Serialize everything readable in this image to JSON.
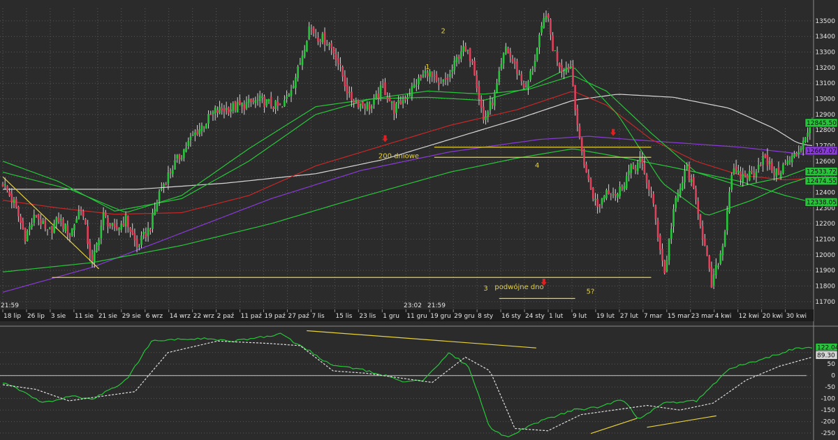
{
  "chart_data": [
    {
      "type": "candlestick",
      "ylim": [
        11650,
        13580
      ],
      "y_ticks": [
        11700,
        11800,
        11900,
        12000,
        12100,
        12200,
        12300,
        12400,
        12500,
        12600,
        12700,
        12800,
        12900,
        13000,
        13100,
        13200,
        13300,
        13400,
        13500
      ],
      "x_tick_labels": [
        "18 lip",
        "26 lip",
        "3 sie",
        "11 sie",
        "21 sie",
        "29 sie",
        "6 wrz",
        "14 wrz",
        "22 wrz",
        "2 paź",
        "11 paź",
        "19 paź",
        "27 paź",
        "7 lis",
        "15 lis",
        "23 lis",
        "1 gru",
        "11 gru",
        "19 gru",
        "29 gru",
        "8 sty",
        "16 sty",
        "24 sty",
        "1 lut",
        "9 lut",
        "19 lut",
        "27 lut",
        "7 mar",
        "15 mar",
        "23 mar",
        "4 kwi",
        "12 kwi",
        "20 kwi",
        "30 kwi"
      ],
      "time_labels": [
        "21:59",
        "23:02",
        "21:59"
      ],
      "grid": true,
      "ohlc_anchors": [
        [
          0,
          12460
        ],
        [
          5,
          12330
        ],
        [
          10,
          12120
        ],
        [
          15,
          12260
        ],
        [
          20,
          12130
        ],
        [
          25,
          12230
        ],
        [
          30,
          12130
        ],
        [
          35,
          12310
        ],
        [
          40,
          11940
        ],
        [
          45,
          12250
        ],
        [
          50,
          12150
        ],
        [
          55,
          12230
        ],
        [
          60,
          12050
        ],
        [
          66,
          12180
        ],
        [
          70,
          12400
        ],
        [
          75,
          12540
        ],
        [
          85,
          12760
        ],
        [
          95,
          12920
        ],
        [
          105,
          12950
        ],
        [
          115,
          12990
        ],
        [
          125,
          12940
        ],
        [
          132,
          13180
        ],
        [
          137,
          13460
        ],
        [
          141,
          13400
        ],
        [
          145,
          13370
        ],
        [
          149,
          13280
        ],
        [
          155,
          13010
        ],
        [
          160,
          12970
        ],
        [
          165,
          12950
        ],
        [
          170,
          13080
        ],
        [
          175,
          12930
        ],
        [
          180,
          13010
        ],
        [
          185,
          13100
        ],
        [
          190,
          13180
        ],
        [
          195,
          13070
        ],
        [
          200,
          13150
        ],
        [
          205,
          13320
        ],
        [
          210,
          13260
        ],
        [
          215,
          12860
        ],
        [
          220,
          13020
        ],
        [
          225,
          13330
        ],
        [
          230,
          13180
        ],
        [
          234,
          13060
        ],
        [
          238,
          13260
        ],
        [
          243,
          13560
        ],
        [
          246,
          13330
        ],
        [
          250,
          13190
        ],
        [
          254,
          13210
        ],
        [
          258,
          12720
        ],
        [
          262,
          12470
        ],
        [
          266,
          12300
        ],
        [
          270,
          12420
        ],
        [
          275,
          12390
        ],
        [
          280,
          12530
        ],
        [
          285,
          12600
        ],
        [
          290,
          12390
        ],
        [
          296,
          11880
        ],
        [
          300,
          12290
        ],
        [
          306,
          12560
        ],
        [
          311,
          12290
        ],
        [
          317,
          11800
        ],
        [
          322,
          12060
        ],
        [
          326,
          12530
        ],
        [
          330,
          12500
        ],
        [
          335,
          12520
        ],
        [
          340,
          12620
        ],
        [
          346,
          12520
        ],
        [
          350,
          12580
        ],
        [
          355,
          12640
        ],
        [
          361,
          12830
        ]
      ],
      "ma_lines": [
        {
          "color": "#d6d6d6",
          "points": [
            [
              0,
              12420
            ],
            [
              25,
              12420
            ],
            [
              60,
              12420
            ],
            [
              100,
              12460
            ],
            [
              140,
              12520
            ],
            [
              170,
              12610
            ],
            [
              200,
              12740
            ],
            [
              230,
              12870
            ],
            [
              255,
              12990
            ],
            [
              275,
              13030
            ],
            [
              300,
              13010
            ],
            [
              325,
              12940
            ],
            [
              345,
              12810
            ],
            [
              355,
              12720
            ],
            [
              361,
              12700
            ]
          ]
        },
        {
          "color": "#8a3ad8",
          "points": [
            [
              0,
              11760
            ],
            [
              40,
              11920
            ],
            [
              80,
              12140
            ],
            [
              120,
              12360
            ],
            [
              160,
              12540
            ],
            [
              200,
              12660
            ],
            [
              240,
              12740
            ],
            [
              262,
              12760
            ],
            [
              280,
              12740
            ],
            [
              300,
              12720
            ],
            [
              330,
              12690
            ],
            [
              355,
              12650
            ],
            [
              361,
              12640
            ]
          ]
        },
        {
          "color": "#c62828",
          "points": [
            [
              0,
              12350
            ],
            [
              25,
              12300
            ],
            [
              50,
              12260
            ],
            [
              80,
              12270
            ],
            [
              110,
              12380
            ],
            [
              140,
              12570
            ],
            [
              170,
              12700
            ],
            [
              200,
              12830
            ],
            [
              230,
              12930
            ],
            [
              255,
              13050
            ],
            [
              270,
              12960
            ],
            [
              290,
              12740
            ],
            [
              310,
              12600
            ],
            [
              330,
              12510
            ],
            [
              350,
              12480
            ],
            [
              361,
              12490
            ]
          ]
        },
        {
          "color": "#27c63a",
          "points": [
            [
              0,
              11890
            ],
            [
              40,
              11950
            ],
            [
              80,
              12060
            ],
            [
              120,
              12200
            ],
            [
              160,
              12370
            ],
            [
              200,
              12530
            ],
            [
              230,
              12620
            ],
            [
              255,
              12680
            ],
            [
              275,
              12630
            ],
            [
              300,
              12560
            ],
            [
              330,
              12470
            ],
            [
              350,
              12380
            ],
            [
              361,
              12340
            ]
          ]
        },
        {
          "color": "#27c63a",
          "points": [
            [
              0,
              12600
            ],
            [
              25,
              12470
            ],
            [
              50,
              12280
            ],
            [
              80,
              12360
            ],
            [
              110,
              12600
            ],
            [
              140,
              12900
            ],
            [
              165,
              13000
            ],
            [
              190,
              13050
            ],
            [
              215,
              13030
            ],
            [
              235,
              13060
            ],
            [
              255,
              13150
            ],
            [
              270,
              13050
            ],
            [
              290,
              12780
            ],
            [
              310,
              12530
            ],
            [
              330,
              12440
            ],
            [
              350,
              12500
            ],
            [
              361,
              12560
            ]
          ]
        },
        {
          "color": "#27c63a",
          "points": [
            [
              0,
              12530
            ],
            [
              30,
              12420
            ],
            [
              55,
              12270
            ],
            [
              80,
              12380
            ],
            [
              110,
              12680
            ],
            [
              140,
              12950
            ],
            [
              165,
              13000
            ],
            [
              190,
              13010
            ],
            [
              215,
              12990
            ],
            [
              235,
              13070
            ],
            [
              255,
              13210
            ],
            [
              275,
              12900
            ],
            [
              295,
              12460
            ],
            [
              315,
              12250
            ],
            [
              335,
              12350
            ],
            [
              350,
              12450
            ],
            [
              361,
              12500
            ]
          ]
        }
      ],
      "hlines": [
        {
          "y": 11855,
          "x0": 22,
          "x1": 290,
          "color": "#e8d23a"
        },
        {
          "y": 12690,
          "x0": 193,
          "x1": 290,
          "color": "#e8d23a"
        },
        {
          "y": 12625,
          "x0": 193,
          "x1": 290,
          "color": "#e8d23a"
        },
        {
          "y": 11720,
          "x0": 222,
          "x1": 256,
          "color": "#e8d23a"
        }
      ],
      "trendlines": [
        {
          "points": [
            [
              0,
              12500
            ],
            [
              43,
              11910
            ]
          ],
          "color": "#e8d23a"
        }
      ],
      "annotations": [
        {
          "text": "2",
          "x": 196,
          "y": 13420
        },
        {
          "text": "1",
          "x": 189,
          "y": 13190
        },
        {
          "text": "200 dniowe",
          "x": 168,
          "y": 12620
        },
        {
          "text": "4",
          "x": 238,
          "y": 12560
        },
        {
          "text": "3",
          "x": 215,
          "y": 11770
        },
        {
          "text": "podwójne dno",
          "x": 220,
          "y": 11780
        },
        {
          "text": "5?",
          "x": 261,
          "y": 11750
        }
      ],
      "arrows": [
        [
          171,
          12740
        ],
        [
          242,
          11820
        ],
        [
          273,
          12780
        ]
      ],
      "price_badges": [
        {
          "label": "12845.50",
          "color": "#27c63a",
          "text_color": "#0d0d0d",
          "y": 12846
        },
        {
          "label": "12667.07",
          "color": "#8a3ad8",
          "text_color": "#0d0d0d",
          "y": 12667
        },
        {
          "label": "12533.72",
          "color": "#27c63a",
          "text_color": "#0d0d0d",
          "y": 12534
        },
        {
          "label": "12474.55",
          "color": "#27c63a",
          "text_color": "#0d0d0d",
          "y": 12475
        },
        {
          "label": "12338.05",
          "color": "#27c63a",
          "text_color": "#0d0d0d",
          "y": 12338
        }
      ]
    },
    {
      "type": "line",
      "ylim": [
        -265,
        160
      ],
      "y_ticks": [
        100,
        50,
        0,
        -50,
        -100,
        -150,
        -200,
        -250
      ],
      "zero_line": 0,
      "series": [
        {
          "style": "solid",
          "color": "#27c63a",
          "points": [
            [
              0,
              -30
            ],
            [
              15,
              -80
            ],
            [
              25,
              -120
            ],
            [
              40,
              -90
            ],
            [
              55,
              -100
            ],
            [
              75,
              -20
            ],
            [
              90,
              150
            ],
            [
              110,
              160
            ],
            [
              120,
              160
            ],
            [
              140,
              150
            ],
            [
              160,
              170
            ],
            [
              168,
              180
            ],
            [
              185,
              110
            ],
            [
              200,
              40
            ],
            [
              215,
              30
            ],
            [
              232,
              0
            ],
            [
              245,
              -30
            ],
            [
              255,
              -20
            ],
            [
              270,
              100
            ],
            [
              282,
              40
            ],
            [
              295,
              -230
            ],
            [
              305,
              -265
            ],
            [
              325,
              -200
            ],
            [
              345,
              -150
            ],
            [
              360,
              -140
            ],
            [
              375,
              -100
            ],
            [
              385,
              -190
            ],
            [
              400,
              -120
            ],
            [
              420,
              -110
            ],
            [
              440,
              30
            ],
            [
              460,
              70
            ],
            [
              480,
              120
            ],
            [
              490,
              120
            ]
          ]
        },
        {
          "style": "dashed",
          "color": "#e0e0e0",
          "points": [
            [
              0,
              -40
            ],
            [
              20,
              -60
            ],
            [
              40,
              -110
            ],
            [
              60,
              -90
            ],
            [
              80,
              -70
            ],
            [
              100,
              100
            ],
            [
              130,
              150
            ],
            [
              160,
              140
            ],
            [
              180,
              130
            ],
            [
              200,
              20
            ],
            [
              220,
              10
            ],
            [
              240,
              -10
            ],
            [
              260,
              -30
            ],
            [
              280,
              80
            ],
            [
              295,
              20
            ],
            [
              310,
              -230
            ],
            [
              330,
              -240
            ],
            [
              350,
              -170
            ],
            [
              370,
              -150
            ],
            [
              390,
              -130
            ],
            [
              410,
              -150
            ],
            [
              430,
              -120
            ],
            [
              450,
              -20
            ],
            [
              470,
              40
            ],
            [
              490,
              80
            ]
          ]
        }
      ],
      "trendlines": [
        {
          "points": [
            [
              184,
              195
            ],
            [
              323,
              120
            ]
          ],
          "color": "#e8d23a"
        },
        {
          "points": [
            [
              356,
              -252
            ],
            [
              384,
              -186
            ]
          ],
          "color": "#e8d23a"
        },
        {
          "points": [
            [
              390,
              -225
            ],
            [
              432,
              -175
            ]
          ],
          "color": "#e8d23a"
        }
      ],
      "value_badges": [
        {
          "label": "122.04",
          "color": "#27c63a",
          "text_color": "#0d0d0d",
          "y": 122
        },
        {
          "label": "89.30",
          "color": "#d6d6d6",
          "text_color": "#0d0d0d",
          "y": 89
        }
      ]
    }
  ]
}
